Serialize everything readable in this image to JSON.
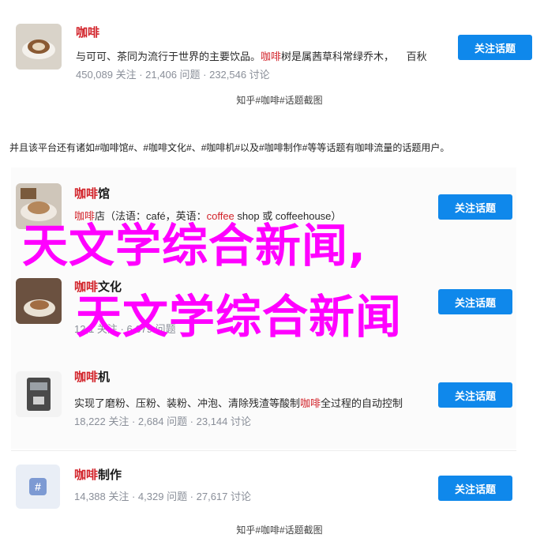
{
  "card1": {
    "title": "咖啡",
    "desc_pre": "与可可、茶同为流行于世界的主要饮品。",
    "desc_hl": "咖啡",
    "desc_post": "树是属茜草科常绿乔木，",
    "desc_tail": "百秋",
    "stats": "450,089 关注  ·  21,406 问题  ·  232,546 讨论",
    "button": "关注话题"
  },
  "caption1": "知乎#咖啡#话题截图",
  "paragraph": "并且该平台还有诸如#咖啡馆#、#咖啡文化#、#咖啡机#以及#咖啡制作#等等话题有咖啡流量的话题用户。",
  "card2": {
    "title_hl": "咖啡",
    "title_rest": "馆",
    "desc_hl": "咖啡",
    "desc_rest": "店（法语：café，英语：",
    "desc_hl2": "coffee",
    "desc_rest2": " shop 或 coffeehouse）",
    "button": "关注话题"
  },
  "card3": {
    "title_hl": "咖啡",
    "title_rest": "文化",
    "stats": "12,1 关注  ·  6,679 问题",
    "button": "关注话题"
  },
  "card4": {
    "title_hl": "咖啡",
    "title_rest": "机",
    "desc_pre": "实现了磨粉、压粉、装粉、冲泡、清除残渣等酸制",
    "desc_hl": "咖啡",
    "desc_post": "全过程的自动控制",
    "stats": "18,222 关注  ·  2,684 问题  ·  23,144 讨论",
    "button": "关注话题"
  },
  "card5": {
    "title_hl": "咖啡",
    "title_rest": "制作",
    "stats": "14,388 关注  ·  4,329 问题  ·  27,617 讨论",
    "button": "关注话题"
  },
  "caption2": "知乎#咖啡#话题截图",
  "watermark": {
    "line1": "天文学综合新闻,",
    "line2": "天文学综合新闻"
  },
  "colors": {
    "accent": "#0f88eb",
    "highlight": "#d2232a",
    "watermark": "#ff00ff"
  }
}
